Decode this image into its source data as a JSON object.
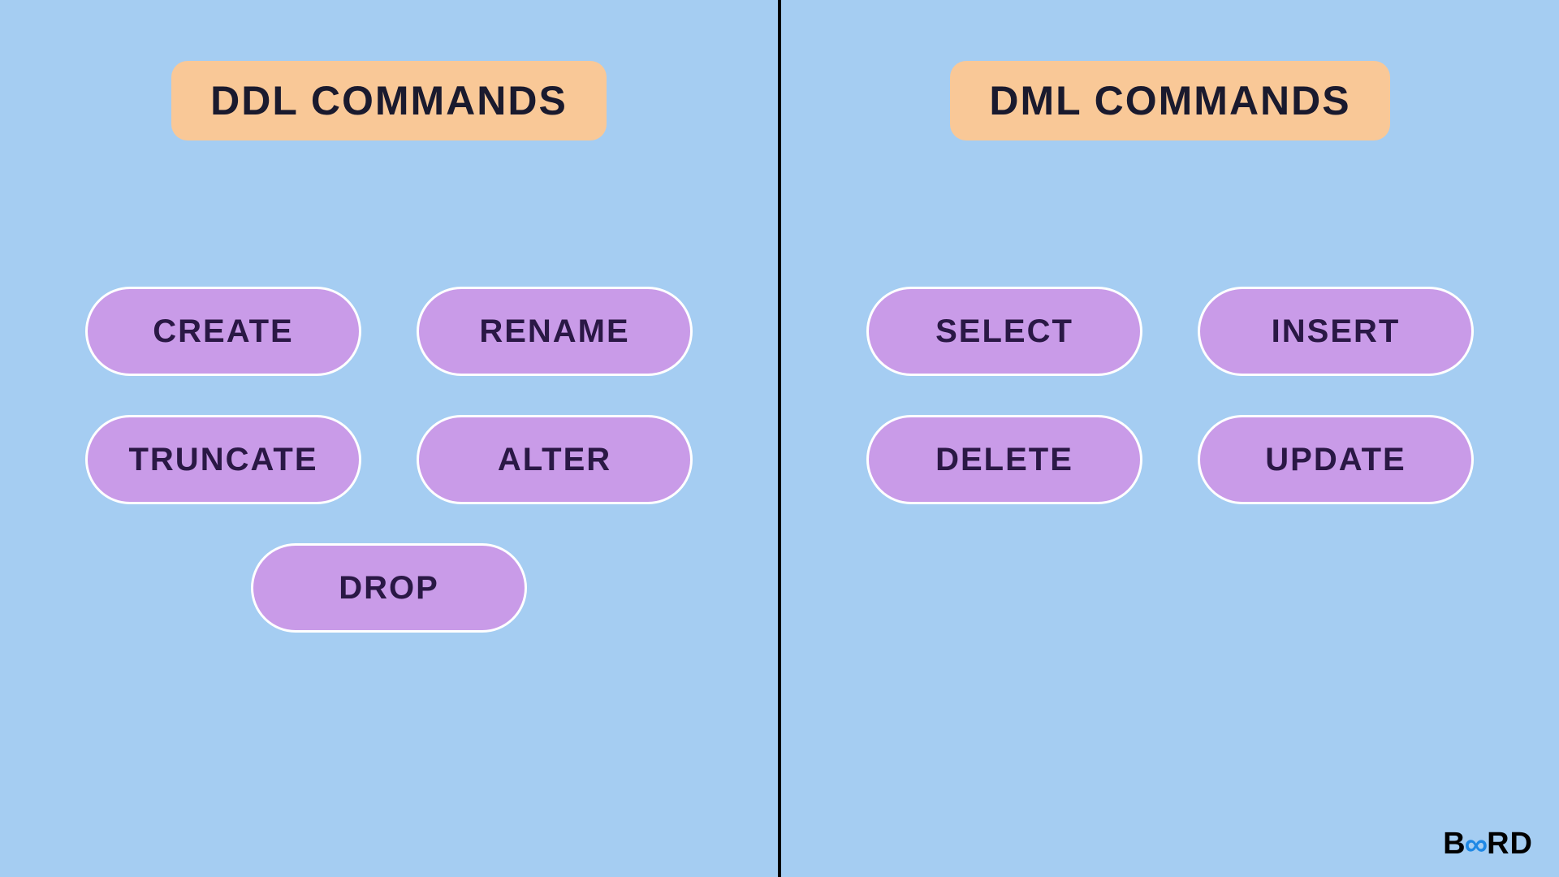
{
  "left": {
    "title": "DDL COMMANDS",
    "commands": [
      "CREATE",
      "RENAME",
      "TRUNCATE",
      "ALTER",
      "DROP"
    ]
  },
  "right": {
    "title": "DML COMMANDS",
    "commands": [
      "SELECT",
      "INSERT",
      "DELETE",
      "UPDATE"
    ]
  },
  "logo": {
    "part1": "B",
    "part2": "∞",
    "part3": "RD"
  }
}
